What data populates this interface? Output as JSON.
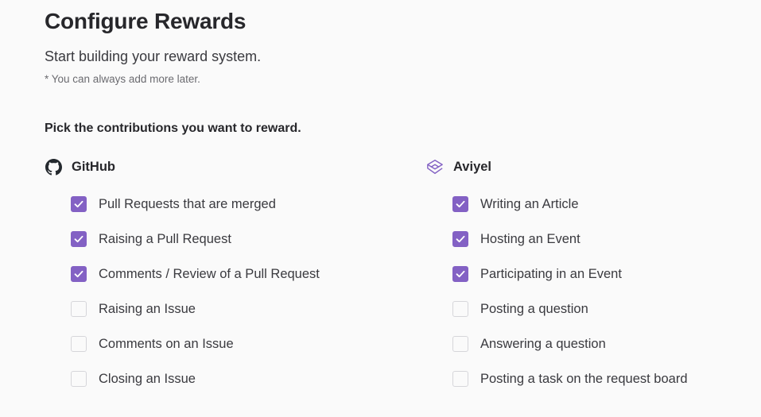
{
  "header": {
    "title": "Configure Rewards",
    "subtitle": "Start building your reward system.",
    "note": "* You can always add more later."
  },
  "prompt": "Pick the contributions you want to reward.",
  "colors": {
    "accent": "#8361c4",
    "checkbox_border": "#d6d6da",
    "background": "#fafafa"
  },
  "sources": [
    {
      "name": "GitHub",
      "icon": "github-icon",
      "items": [
        {
          "label": "Pull Requests that are merged",
          "checked": true
        },
        {
          "label": "Raising a Pull Request",
          "checked": true
        },
        {
          "label": "Comments / Review of a Pull Request",
          "checked": true
        },
        {
          "label": "Raising an Issue",
          "checked": false
        },
        {
          "label": "Comments on an Issue",
          "checked": false
        },
        {
          "label": "Closing an Issue",
          "checked": false
        }
      ]
    },
    {
      "name": "Aviyel",
      "icon": "aviyel-logo-icon",
      "items": [
        {
          "label": "Writing an Article",
          "checked": true
        },
        {
          "label": "Hosting an Event",
          "checked": true
        },
        {
          "label": "Participating in an Event",
          "checked": true
        },
        {
          "label": "Posting a question",
          "checked": false
        },
        {
          "label": "Answering a question",
          "checked": false
        },
        {
          "label": "Posting a task on the request board",
          "checked": false
        }
      ]
    }
  ]
}
